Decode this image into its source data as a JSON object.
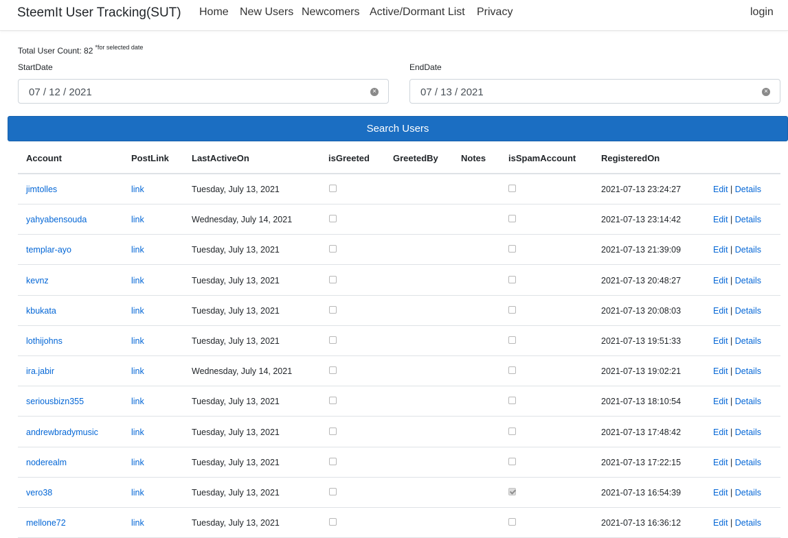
{
  "nav": {
    "brand": "SteemIt User Tracking(SUT)",
    "links": [
      "Home",
      "New Users",
      "Newcomers",
      "Active/Dormant List",
      "Privacy"
    ],
    "login": "login"
  },
  "summary": {
    "text": "Total User Count: 82",
    "note": "*for selected date"
  },
  "filters": {
    "start_label": "StartDate",
    "start_value": "07 / 12 / 2021",
    "end_label": "EndDate",
    "end_value": "07 / 13 / 2021"
  },
  "search_button": "Search Users",
  "table": {
    "headers": [
      "Account",
      "PostLink",
      "LastActiveOn",
      "isGreeted",
      "GreetedBy",
      "Notes",
      "isSpamAccount",
      "RegisteredOn"
    ],
    "link_text": "link",
    "edit_text": "Edit",
    "divider": "|",
    "details_text": "Details",
    "rows": [
      {
        "account": "jimtolles",
        "last_active": "Tuesday, July 13, 2021",
        "greeted": false,
        "spam": false,
        "registered": "2021-07-13 23:24:27"
      },
      {
        "account": "yahyabensouda",
        "last_active": "Wednesday, July 14, 2021",
        "greeted": false,
        "spam": false,
        "registered": "2021-07-13 23:14:42"
      },
      {
        "account": "templar-ayo",
        "last_active": "Tuesday, July 13, 2021",
        "greeted": false,
        "spam": false,
        "registered": "2021-07-13 21:39:09"
      },
      {
        "account": "kevnz",
        "last_active": "Tuesday, July 13, 2021",
        "greeted": false,
        "spam": false,
        "registered": "2021-07-13 20:48:27"
      },
      {
        "account": "kbukata",
        "last_active": "Tuesday, July 13, 2021",
        "greeted": false,
        "spam": false,
        "registered": "2021-07-13 20:08:03"
      },
      {
        "account": "lothijohns",
        "last_active": "Tuesday, July 13, 2021",
        "greeted": false,
        "spam": false,
        "registered": "2021-07-13 19:51:33"
      },
      {
        "account": "ira.jabir",
        "last_active": "Wednesday, July 14, 2021",
        "greeted": false,
        "spam": false,
        "registered": "2021-07-13 19:02:21"
      },
      {
        "account": "seriousbizn355",
        "last_active": "Tuesday, July 13, 2021",
        "greeted": false,
        "spam": false,
        "registered": "2021-07-13 18:10:54"
      },
      {
        "account": "andrewbradymusic",
        "last_active": "Tuesday, July 13, 2021",
        "greeted": false,
        "spam": false,
        "registered": "2021-07-13 17:48:42"
      },
      {
        "account": "noderealm",
        "last_active": "Tuesday, July 13, 2021",
        "greeted": false,
        "spam": false,
        "registered": "2021-07-13 17:22:15"
      },
      {
        "account": "vero38",
        "last_active": "Tuesday, July 13, 2021",
        "greeted": false,
        "spam": true,
        "registered": "2021-07-13 16:54:39"
      },
      {
        "account": "mellone72",
        "last_active": "Tuesday, July 13, 2021",
        "greeted": false,
        "spam": false,
        "registered": "2021-07-13 16:36:12"
      }
    ]
  }
}
